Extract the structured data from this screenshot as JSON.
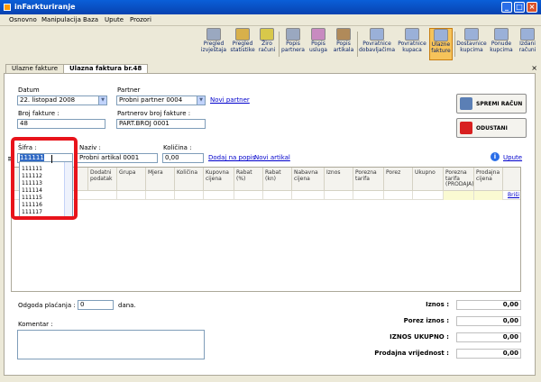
{
  "window": {
    "title": "inFarkturiranje"
  },
  "menu": [
    "Osnovno",
    "Manipulacija",
    "Baza",
    "Upute",
    "Prozori"
  ],
  "toolbar": [
    {
      "label": "Pregled izvještaja",
      "icon": "report-icon",
      "color": "#9aa8c0"
    },
    {
      "label": "Pregled statistike",
      "icon": "stats-icon",
      "color": "#d8b04a"
    },
    {
      "label": "Žiro računi",
      "icon": "bank-icon",
      "color": "#d8c84a"
    },
    {
      "label": "Popis partnera",
      "icon": "partners-icon",
      "color": "#9aa8c0"
    },
    {
      "label": "Popis usluga",
      "icon": "services-icon",
      "color": "#c88ac0"
    },
    {
      "label": "Popis artikala",
      "icon": "items-icon",
      "color": "#b08a5a"
    },
    {
      "label": "Povratnice dobavljačima",
      "icon": "return-supplier-icon",
      "color": "#9ab0d8"
    },
    {
      "label": "Povratnice kupaca",
      "icon": "return-customer-icon",
      "color": "#9ab0d8"
    },
    {
      "label": "Ulazne fakture",
      "icon": "incoming-invoice-icon",
      "color": "#9ab0d8",
      "active": true
    },
    {
      "label": "Dostavnice kupcima",
      "icon": "delivery-icon",
      "color": "#9ab0d8"
    },
    {
      "label": "Ponude kupcima",
      "icon": "offer-icon",
      "color": "#9ab0d8"
    },
    {
      "label": "Izdani računi",
      "icon": "issued-invoice-icon",
      "color": "#9ab0d8"
    }
  ],
  "tabs": [
    "Ulazne fakture",
    "Ulazna faktura br.48"
  ],
  "form": {
    "datum_label": "Datum",
    "datum_value": "22. listopad 2008",
    "partner_label": "Partner",
    "partner_value": "Probni partner 0004",
    "novi_partner": "Novi partner",
    "broj_label": "Broj fakture :",
    "broj_value": "48",
    "partnerov_broj_label": "Partnerov broj fakture :",
    "partnerov_broj_value": "PART.BROJ 0001",
    "sifra_label": "Šifra :",
    "sifra_value": "111111",
    "naziv_label": "Naziv :",
    "naziv_value": "Probni artikal 0001",
    "kolicina_label": "Količina :",
    "kolicina_value": "0,00",
    "dodaj_popis": "Dodaj na popis",
    "novi_artikal": "Novi artikal",
    "upute": "Upute",
    "spremi": "SPREMI RAČUN",
    "odustani": "ODUSTANI"
  },
  "dropdown_items": [
    "111111",
    "111112",
    "111113",
    "111114",
    "111115",
    "111116",
    "111117"
  ],
  "grid_headers": [
    "Dodatni podatak",
    "Grupa",
    "Mjera",
    "Količina",
    "Kupovna cijena",
    "Rabat (%)",
    "Rabat (kn)",
    "Nabavna cijena",
    "Iznos",
    "Porezna tarifa",
    "Porez",
    "Ukupno",
    "Porezna tarifa (PRODAJA)",
    "Prodajna cijena"
  ],
  "grid_action": "Briši",
  "footer": {
    "odgoda_label": "Odgoda plaćanja :",
    "odgoda_value": "0",
    "dana": "dana.",
    "komentar_label": "Komentar :",
    "sums": [
      {
        "label": "Iznos :",
        "value": "0,00"
      },
      {
        "label": "Porez iznos :",
        "value": "0,00"
      },
      {
        "label": "IZNOS UKUPNO :",
        "value": "0,00"
      },
      {
        "label": "Prodajna vrijednost :",
        "value": "0,00"
      }
    ]
  }
}
